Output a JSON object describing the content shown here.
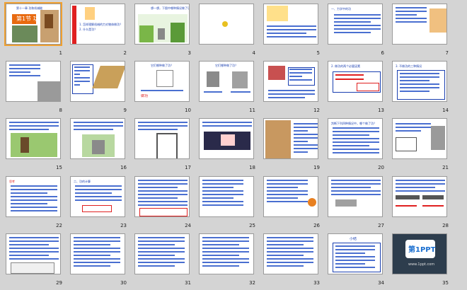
{
  "view": "slide-sorter",
  "slide_count": 35,
  "selected_slide": 1,
  "slides": [
    {
      "n": "1",
      "title": "第十一章 功和机械能",
      "heading": "第1节 功"
    },
    {
      "n": "2",
      "q1": "1. 怎样理解机械的力对物体做功？",
      "q2": "2. 什么是功？"
    },
    {
      "n": "3",
      "caption": "想一想，下图中哪种情况做了功？"
    },
    {
      "n": "4"
    },
    {
      "n": "5"
    },
    {
      "n": "6",
      "heading": "一、力学中的功"
    },
    {
      "n": "7"
    },
    {
      "n": "8"
    },
    {
      "n": "9"
    },
    {
      "n": "10",
      "title": "它们哪种做了功？",
      "answer": "做功"
    },
    {
      "n": "11",
      "title": "它们哪种做了功？"
    },
    {
      "n": "12"
    },
    {
      "n": "13",
      "heading": "2. 做功的两个必要因素"
    },
    {
      "n": "14",
      "heading": "3. 不做功的三种情况"
    },
    {
      "n": "15"
    },
    {
      "n": "16"
    },
    {
      "n": "17"
    },
    {
      "n": "18"
    },
    {
      "n": "19"
    },
    {
      "n": "20",
      "heading": "判断下列四种情况中，哪个做了功？"
    },
    {
      "n": "21"
    },
    {
      "n": "22",
      "heading": "思考"
    },
    {
      "n": "23",
      "heading": "二、功的计算"
    },
    {
      "n": "24"
    },
    {
      "n": "25"
    },
    {
      "n": "26"
    },
    {
      "n": "27"
    },
    {
      "n": "28"
    },
    {
      "n": "29"
    },
    {
      "n": "30"
    },
    {
      "n": "31"
    },
    {
      "n": "32"
    },
    {
      "n": "33"
    },
    {
      "n": "34",
      "heading": "小结"
    },
    {
      "n": "35",
      "logo": "第1PPT",
      "site": "www.1ppt.com"
    }
  ],
  "colors": {
    "background": "#d4d4d4",
    "selection": "#f0a030",
    "title_blue": "#1a3fb0",
    "accent_red": "#e02020"
  }
}
